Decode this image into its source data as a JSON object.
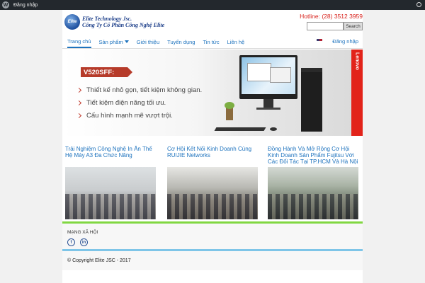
{
  "admin_bar": {
    "wp_label": "W",
    "login_label": "Đăng nhập"
  },
  "header": {
    "logo_text": "Elite",
    "brand_line1": "Elite Technology Jsc.",
    "brand_line2": "Công Ty Cổ Phần Công Nghệ Elite",
    "hotline": "Hotline: (28) 3512 3959",
    "search_placeholder": "",
    "search_label": "Search"
  },
  "nav": {
    "items": [
      "Trang chủ",
      "Sản phẩm",
      "Giới thiệu",
      "Tuyển dụng",
      "Tin tức",
      "Liên hệ"
    ],
    "login": "Đăng nhập"
  },
  "banner": {
    "model": "V520SFF:",
    "features": [
      "Thiết kế nhỏ gọn, tiết kiệm không gian.",
      "Tiết kiệm điện năng tối ưu.",
      "Cấu hình mạnh mẽ vượt trội."
    ],
    "brand": "Lenovo"
  },
  "news": [
    {
      "title": "Trải Nghiệm Công Nghệ In Ấn Thế Hệ Máy A3 Đa Chức Năng"
    },
    {
      "title": "Cơ Hội Kết Nối Kinh Doanh Cùng RUIJIE Networks"
    },
    {
      "title": "Đồng Hành Và Mở Rộng Cơ Hội Kinh Doanh Sản Phẩm Fujitsu Với Các Đối Tác Tại TP.HCM Và Hà Nội"
    }
  ],
  "footer": {
    "social_title": "MẠNG XÃ HỘI",
    "facebook_glyph": "f",
    "linkedin_glyph": "in",
    "copyright": "© Copyright Elite JSC - 2017"
  },
  "colors": {
    "accent": "#1e73be",
    "hotline": "#d8211b",
    "green_bar": "#81d742",
    "blue_bar": "#7ec5e8",
    "lenovo_red": "#e2231a"
  }
}
